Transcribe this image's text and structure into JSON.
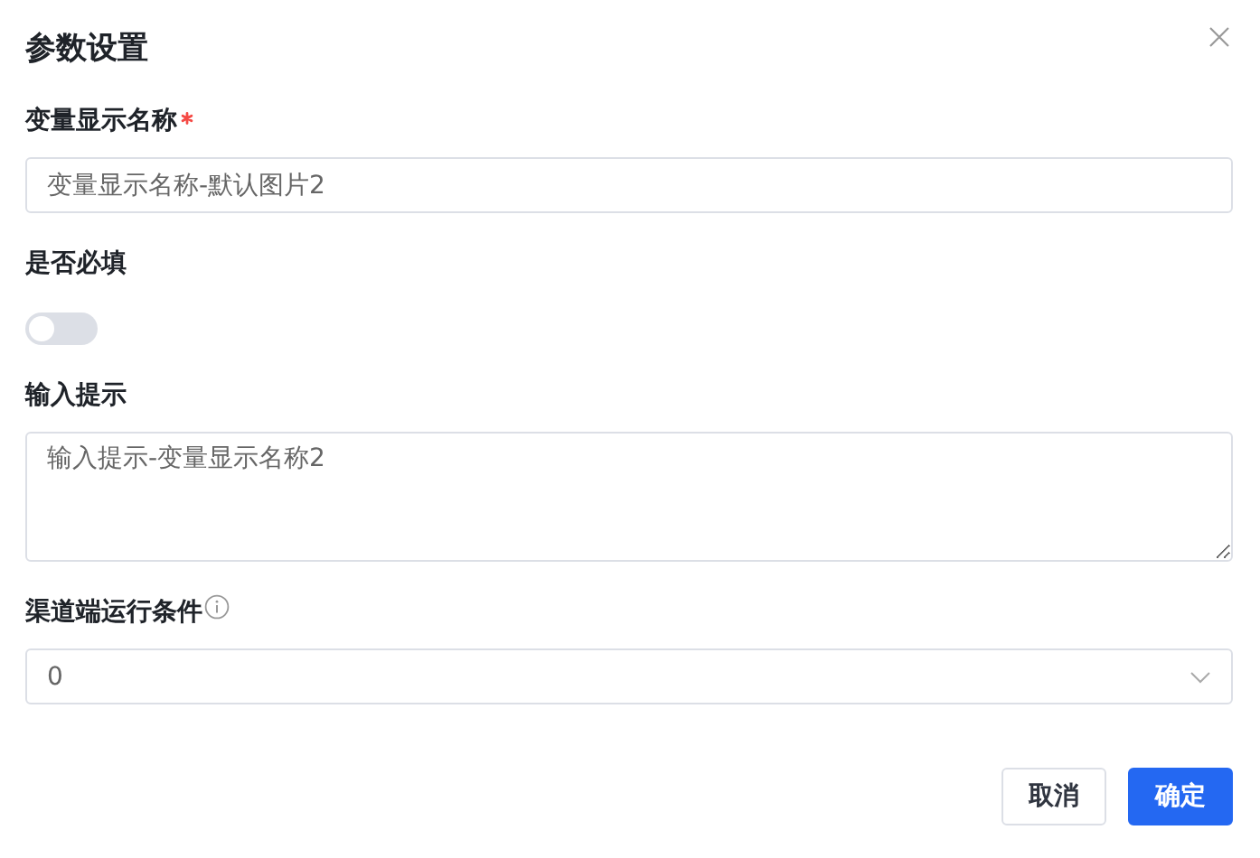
{
  "dialog": {
    "title": "参数设置"
  },
  "fields": [
    {
      "kind": "text",
      "label": "变量显示名称",
      "required": true,
      "info": false,
      "value": "变量显示名称-默认图片2"
    },
    {
      "kind": "switch",
      "label": "是否必填",
      "required": false,
      "info": false,
      "on": false
    },
    {
      "kind": "textarea",
      "label": "输入提示",
      "required": false,
      "info": false,
      "value": "输入提示-变量显示名称2"
    },
    {
      "kind": "select",
      "label": "渠道端运行条件",
      "required": false,
      "info": true,
      "value": "0"
    }
  ],
  "buttons": [
    {
      "kind": "secondary",
      "label": "取消"
    },
    {
      "kind": "primary",
      "label": "确定"
    }
  ]
}
